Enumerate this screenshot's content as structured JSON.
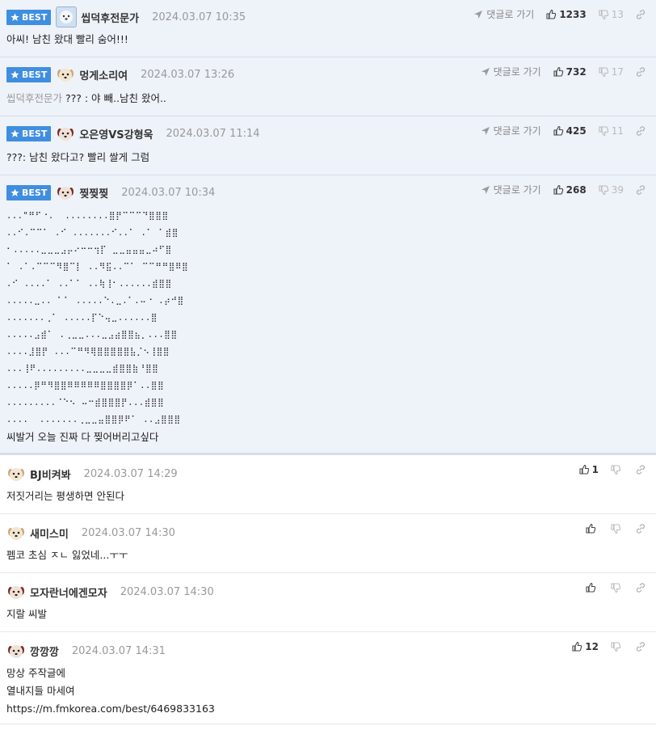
{
  "comments": [
    {
      "best": true,
      "badge": "BEST",
      "avatar": "ice-bear",
      "nick": "씹덕후전문가",
      "date": "2024.03.07 10:35",
      "reply_link": "댓글로 가기",
      "up": "1233",
      "down": "13",
      "text": "아씨! 남친 왔대 빨리 숨어!!!"
    },
    {
      "best": true,
      "badge": "BEST",
      "avatar": "puppy",
      "nick": "멍게소리여",
      "date": "2024.03.07 13:26",
      "reply_link": "댓글로 가기",
      "up": "732",
      "down": "17",
      "quote": "씹덕후전문가",
      "text": " ??? : 야 빼..남친 왔어.."
    },
    {
      "best": true,
      "badge": "BEST",
      "avatar": "red-puppy",
      "nick": "오은영VS강형욱",
      "date": "2024.03.07 11:14",
      "reply_link": "댓글로 가기",
      "up": "425",
      "down": "11",
      "text": "???: 남친 왔다고? 빨리 쌀게 그럼"
    },
    {
      "best": true,
      "badge": "BEST",
      "avatar": "red-puppy",
      "nick": "찢찢찢",
      "date": "2024.03.07 10:34",
      "reply_link": "댓글로 가기",
      "up": "268",
      "down": "39",
      "art": "...\"⠛⠋⠐.  ........⣿⡟⠉⠉⠉⠙⣿⣿⣿\n..⠊.⠉⠉⠁ .⠊ .......⠊..⠁ .⠁ ⠁⣾⣿\n⠂.....⣀⣀⣀⣠⡤⠔⠒⠒⢲⡏ ⣀⣀⣤⣤⣤⣀⠴⠋⣿\n⠁ .⠁.⠉⠉⠉⠻⣿⠉⡇ ..⠻⣯..⠉⠁ ⠉⠉⠛⠛⣿⠿⣿\n.⠊ ....⠁ ..⠁⠁ ..⢷⢸⠂......⣾⣿⣿\n.....⣀.. ⠁⠁ .....⠑.⣀.⠁.⠤⠐ .⡴⠚⣿\n.......⢀⠁ .....⡏⠑⢤⣀......⣿\n.....⣠⣾⠁ .⢀⣀⣀...⣀⣠⣴⣿⣿⣦⡀...⣿⣿\n....⣸⣿⡟ ...⠉⠛⠻⢿⣿⣿⣿⣿⣿⣧⡈⠢⢸⣿⣿\n...⢸⠟.........⣀⣀⣀⣀⣾⣿⣿⣷⠘⣿⣿\n.....⡿⠛⠻⣿⣿⠿⠿⠿⠿⠿⣿⣿⣿⣿⡿⠁..⣿⣿\n.........⠈⠑⠢ ⠤⠒⣾⣿⣿⣿⡟...⣾⣿⣿\n....  .......⢀⣀⣀⣤⣿⣿⡿⠟⠁ ..⣠⣿⣿⣿",
      "text": "씨발거 오늘 진짜 다 찢어버리고싶다"
    },
    {
      "best": false,
      "avatar": "puppy",
      "nick": "BJ비켜봐",
      "date": "2024.03.07 14:29",
      "up": "1",
      "down": "",
      "text": "저짓거리는 평생하면 안된다"
    },
    {
      "best": false,
      "avatar": "puppy",
      "nick": "새미스미",
      "date": "2024.03.07 14:30",
      "up": "",
      "down": "",
      "text": "펨코 초심 ㅈㄴ 잃었네...ㅜㅜ"
    },
    {
      "best": false,
      "avatar": "red-puppy",
      "nick": "모자란너에겐모자",
      "date": "2024.03.07 14:30",
      "up": "",
      "down": "",
      "text": "지랄 씨발"
    },
    {
      "best": false,
      "avatar": "red-puppy",
      "nick": "깡깡깡",
      "date": "2024.03.07 14:31",
      "up": "12",
      "down": "",
      "text_lines": [
        "망상 주작글에",
        "열내지들 마세여",
        "https://m.fmkorea.com/best/6469833163"
      ]
    }
  ]
}
